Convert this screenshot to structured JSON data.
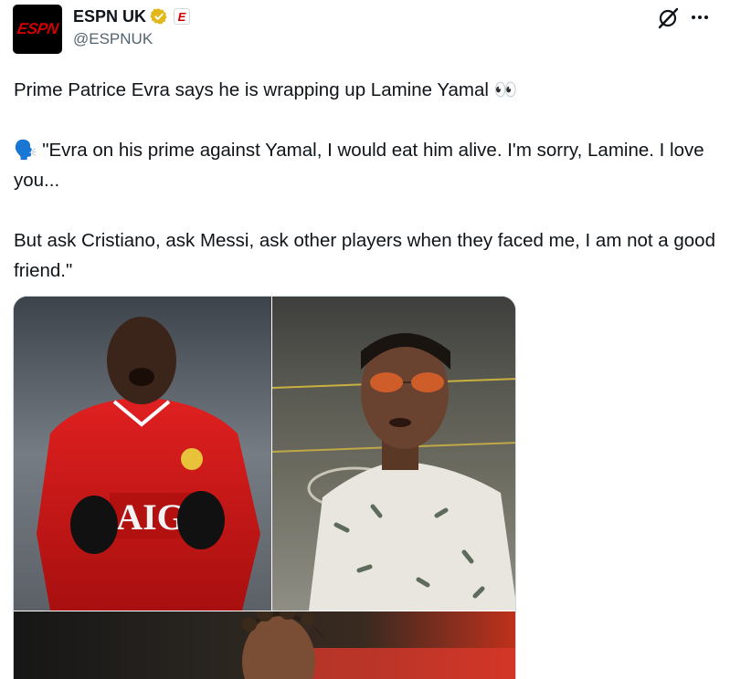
{
  "account": {
    "display_name": "ESPN UK",
    "handle": "@ESPNUK",
    "avatar_logo": "ESPN",
    "affiliate_badge": "E",
    "verified_color": "#e2b719"
  },
  "tweet": {
    "text": "Prime Patrice Evra says he is wrapping up Lamine Yamal 👀\n\n🗣️ \"Evra on his prime against Yamal, I would eat him alive. I'm sorry, Lamine. I love you...\n\nBut ask Cristiano, ask Messi, ask other players when they faced me, I am not a good friend.\""
  },
  "icons": {
    "grok": "grok-icon",
    "more": "more-options-icon",
    "verified": "verified-badge-icon"
  },
  "colors": {
    "text": "#0f1419",
    "secondary": "#536471",
    "brand_red": "#d00000"
  }
}
